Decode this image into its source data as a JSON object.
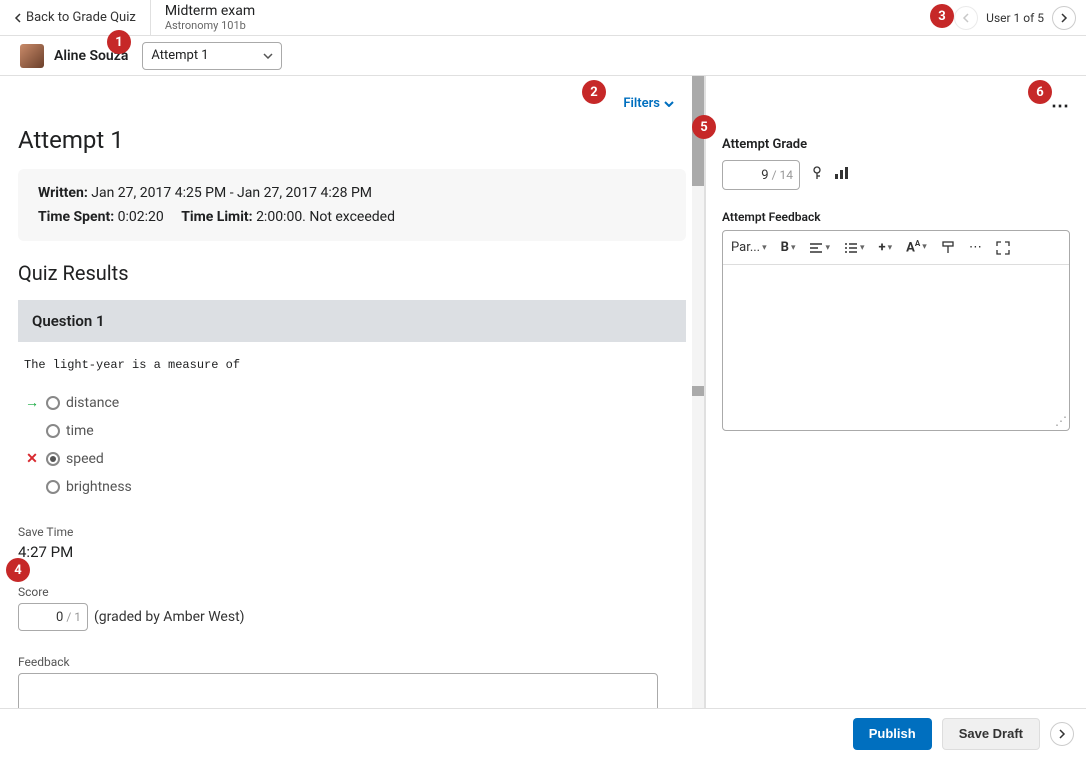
{
  "header": {
    "back_label": "Back to Grade Quiz",
    "title": "Midterm exam",
    "subtitle": "Astronomy 101b",
    "user_count": "User 1 of 5"
  },
  "subheader": {
    "user_name": "Aline Souza",
    "attempt_selected": "Attempt 1"
  },
  "filters_label": "Filters",
  "attempt_title": "Attempt 1",
  "info": {
    "written_label": "Written:",
    "written_value": "Jan 27, 2017 4:25 PM - Jan 27, 2017 4:28 PM",
    "time_spent_label": "Time Spent:",
    "time_spent_value": "0:02:20",
    "time_limit_label": "Time Limit:",
    "time_limit_value": "2:00:00. Not exceeded"
  },
  "results_title": "Quiz Results",
  "question": {
    "header": "Question 1",
    "text": "The light-year is a measure of",
    "options": {
      "a": "distance",
      "b": "time",
      "c": "speed",
      "d": "brightness"
    }
  },
  "save_time_label": "Save Time",
  "save_time_value": "4:27 PM",
  "score_label": "Score",
  "score_got": "0",
  "score_of": "/ 1",
  "graded_by": "(graded by Amber West)",
  "q_feedback_label": "Feedback",
  "right": {
    "grade_label": "Attempt Grade",
    "grade_got": "9",
    "grade_of": "/ 14",
    "feedback_label": "Attempt Feedback",
    "toolbar_para": "Par..."
  },
  "footer": {
    "publish": "Publish",
    "save_draft": "Save Draft"
  },
  "callouts": {
    "c1": "1",
    "c2": "2",
    "c3": "3",
    "c4": "4",
    "c5": "5",
    "c6": "6"
  }
}
